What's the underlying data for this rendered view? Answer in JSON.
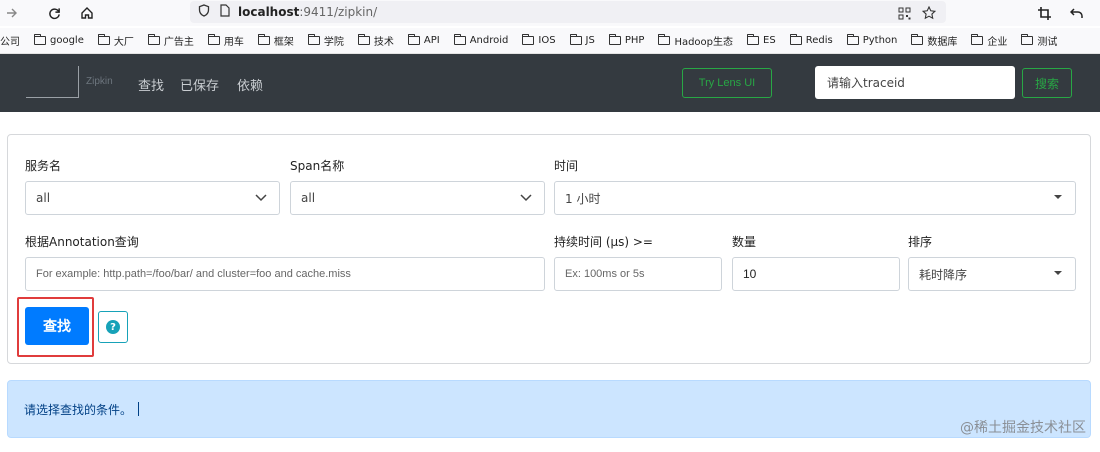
{
  "browser": {
    "url_host": "localhost",
    "url_path": ":9411/zipkin/",
    "icons": [
      "forward-icon",
      "reload-icon",
      "home-icon",
      "shield-icon",
      "page-icon",
      "qr-icon",
      "star-icon",
      "crop-icon",
      "back-arrow-icon"
    ]
  },
  "bookmarks": [
    {
      "label": "公司",
      "icon": ""
    },
    {
      "label": "google",
      "icon": "folder"
    },
    {
      "label": "大厂",
      "icon": "folder"
    },
    {
      "label": "广告主",
      "icon": "folder"
    },
    {
      "label": "用车",
      "icon": "folder"
    },
    {
      "label": "框架",
      "icon": "folder"
    },
    {
      "label": "学院",
      "icon": "folder"
    },
    {
      "label": "技术",
      "icon": "folder"
    },
    {
      "label": "API",
      "icon": "folder"
    },
    {
      "label": "Android",
      "icon": "folder"
    },
    {
      "label": "IOS",
      "icon": "folder"
    },
    {
      "label": "JS",
      "icon": "folder"
    },
    {
      "label": "PHP",
      "icon": "folder"
    },
    {
      "label": "Hadoop生态",
      "icon": "folder"
    },
    {
      "label": "ES",
      "icon": "folder"
    },
    {
      "label": "Redis",
      "icon": "folder"
    },
    {
      "label": "Python",
      "icon": "folder"
    },
    {
      "label": "数据库",
      "icon": "folder"
    },
    {
      "label": "企业",
      "icon": "folder"
    },
    {
      "label": "测试",
      "icon": "folder"
    }
  ],
  "header": {
    "brand": "Zipkin",
    "nav": [
      "查找",
      "已保存",
      "依赖"
    ],
    "lens_button": "Try Lens UI",
    "trace_placeholder": "请输入traceid",
    "search_button": "搜索"
  },
  "form": {
    "service_label": "服务名",
    "service_value": "all",
    "span_label": "Span名称",
    "span_value": "all",
    "time_label": "时间",
    "time_value": "1 小时",
    "annotation_label": "根据Annotation查询",
    "annotation_placeholder": "For example: http.path=/foo/bar/ and cluster=foo and cache.miss",
    "duration_label": "持续时间 (μs) >=",
    "duration_placeholder": "Ex: 100ms or 5s",
    "count_label": "数量",
    "count_value": "10",
    "sort_label": "排序",
    "sort_value": "耗时降序",
    "find_button": "查找",
    "help_symbol": "?"
  },
  "alert": {
    "message": "请选择查找的条件。"
  },
  "watermark": "@稀土掘金技术社区",
  "colors": {
    "header_bg": "#343a40",
    "accent_green": "#28a745",
    "primary_blue": "#007bff",
    "info_bg": "#cce5ff",
    "highlight_red": "#e03c3c"
  }
}
